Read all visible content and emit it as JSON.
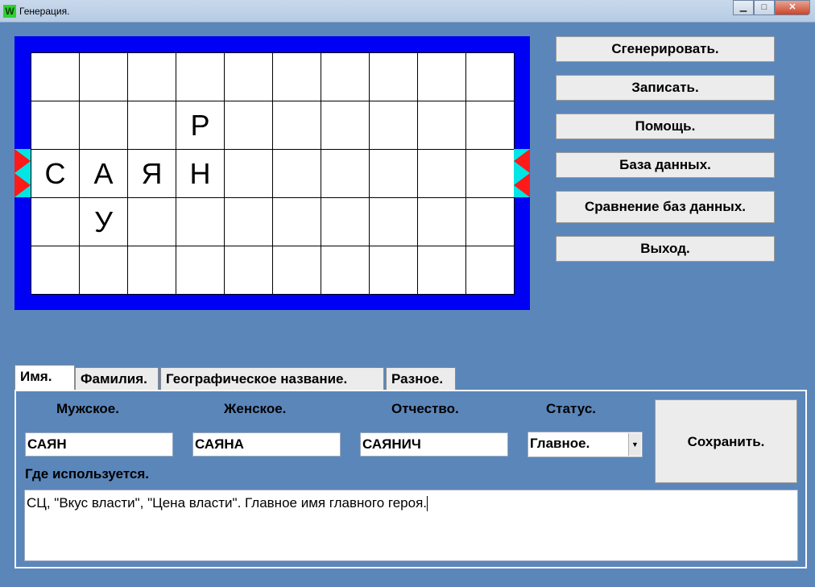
{
  "window": {
    "title": "Генерация.",
    "icon_letter": "W",
    "controls": {
      "minimize": "▁",
      "maximize": "□",
      "close": "✕"
    }
  },
  "board": {
    "rows": [
      [
        "",
        "",
        "",
        "",
        "",
        "",
        "",
        "",
        "",
        ""
      ],
      [
        "",
        "",
        "",
        "Р",
        "",
        "",
        "",
        "",
        "",
        ""
      ],
      [
        "С",
        "А",
        "Я",
        "Н",
        "",
        "",
        "",
        "",
        "",
        ""
      ],
      [
        "",
        "У",
        "",
        "",
        "",
        "",
        "",
        "",
        "",
        ""
      ],
      [
        "",
        "",
        "",
        "",
        "",
        "",
        "",
        "",
        "",
        ""
      ]
    ],
    "colors": {
      "frame": "#0000f5",
      "marker": "#00e5e5",
      "arrow": "#ff1a1a"
    }
  },
  "actions": {
    "generate": "Сгенерировать.",
    "write": "Записать.",
    "help": "Помощь.",
    "database": "База данных.",
    "compare": "Сравнение баз данных.",
    "exit": "Выход."
  },
  "tabs": [
    "Имя.",
    "Фамилия.",
    "Географическое название.",
    "Разное."
  ],
  "form": {
    "male_label": "Мужское.",
    "female_label": "Женское.",
    "patronymic_label": "Отчество.",
    "status_label": "Статус.",
    "male_value": "САЯН",
    "female_value": "САЯНА",
    "patronymic_value": "САЯНИЧ",
    "status_value": "Главное.",
    "usage_label": "Где используется.",
    "usage_text": "СЦ, \"Вкус власти\", \"Цена власти\". Главное имя главного героя.",
    "save": "Сохранить."
  }
}
